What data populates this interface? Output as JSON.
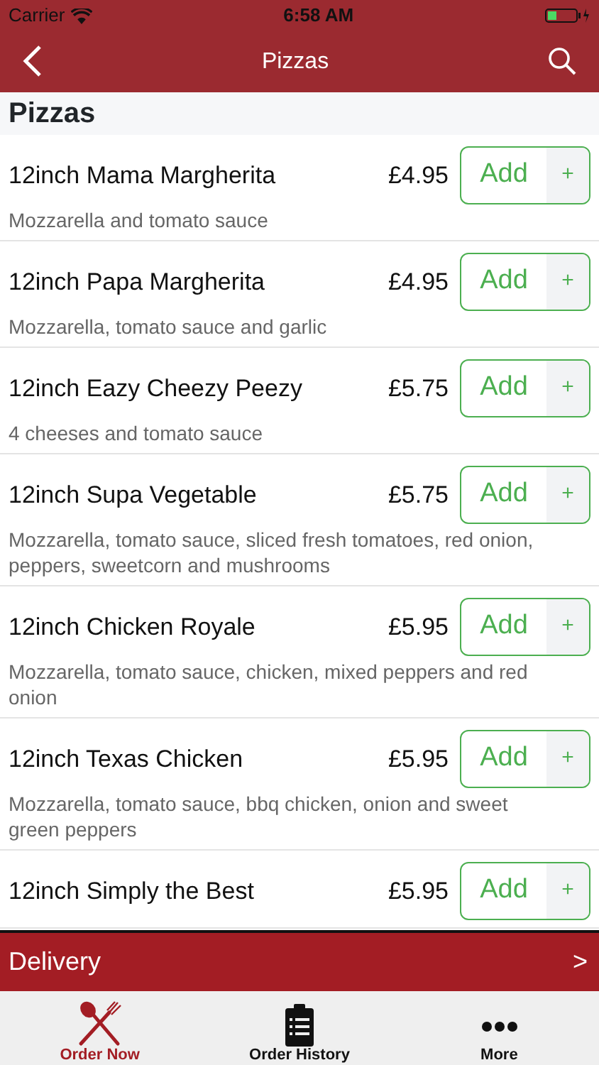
{
  "status_bar": {
    "carrier": "Carrier",
    "time": "6:58 AM"
  },
  "nav_bar": {
    "title": "Pizzas"
  },
  "section": {
    "title": "Pizzas"
  },
  "items": [
    {
      "name": "12inch Mama Margherita",
      "price": "£4.95",
      "description": "Mozzarella and tomato sauce",
      "add": "Add",
      "plus": "+"
    },
    {
      "name": "12inch Papa Margherita",
      "price": "£4.95",
      "description": "Mozzarella, tomato sauce and garlic",
      "add": "Add",
      "plus": "+"
    },
    {
      "name": "12inch Eazy Cheezy Peezy",
      "price": "£5.75",
      "description": "4 cheeses and tomato sauce",
      "add": "Add",
      "plus": "+"
    },
    {
      "name": "12inch Supa Vegetable",
      "price": "£5.75",
      "description": "Mozzarella, tomato sauce, sliced fresh tomatoes, red onion, peppers, sweetcorn and mushrooms",
      "add": "Add",
      "plus": "+"
    },
    {
      "name": "12inch Chicken Royale",
      "price": "£5.95",
      "description": "Mozzarella, tomato sauce, chicken, mixed peppers and red onion",
      "add": "Add",
      "plus": "+"
    },
    {
      "name": "12inch Texas Chicken",
      "price": "£5.95",
      "description": "Mozzarella, tomato sauce, bbq chicken, onion and sweet green peppers",
      "add": "Add",
      "plus": "+"
    },
    {
      "name": "12inch Simply the Best",
      "price": "£5.95",
      "add": "Add",
      "plus": "+"
    }
  ],
  "delivery_bar": {
    "label": "Delivery",
    "arrow": ">"
  },
  "tabs": [
    {
      "label": "Order Now",
      "kind": "cutlery",
      "selected": true
    },
    {
      "label": "Order History",
      "kind": "clipboard",
      "selected": false
    },
    {
      "label": "More",
      "kind": "dots",
      "selected": false
    }
  ]
}
